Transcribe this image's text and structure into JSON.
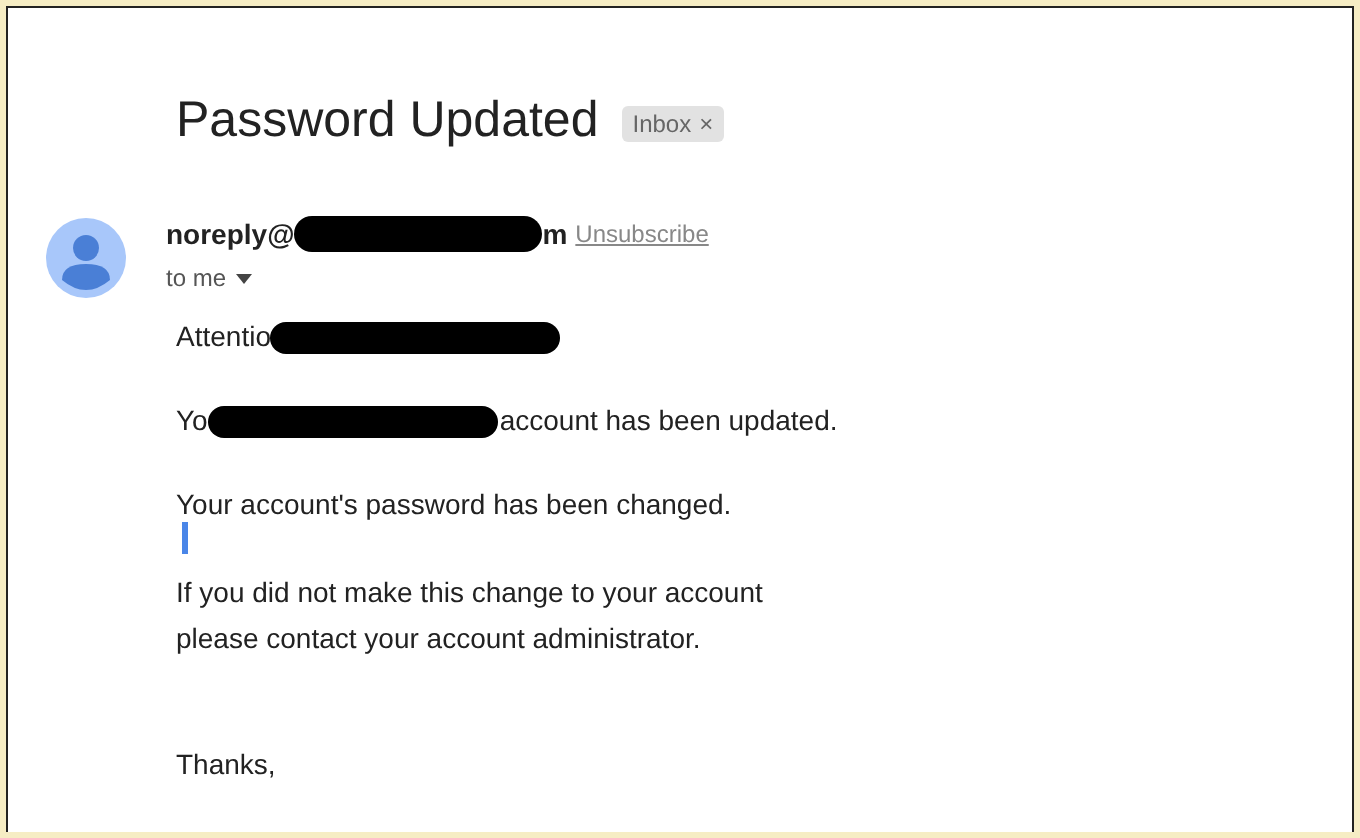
{
  "subject": "Password Updated",
  "label": {
    "text": "Inbox",
    "close": "×"
  },
  "sender": {
    "parts": [
      "noreply@",
      "m"
    ],
    "unsubscribe": "Unsubscribe",
    "recipient": "to me"
  },
  "body": [
    {
      "kind": "paragraph",
      "lines": [
        [
          {
            "kind": "text",
            "text": "Attentio"
          },
          {
            "kind": "redaction"
          }
        ]
      ]
    },
    {
      "kind": "paragraph",
      "lines": [
        [
          {
            "kind": "text",
            "text": "Yo"
          },
          {
            "kind": "redaction"
          },
          {
            "kind": "text",
            "text": "account has been updated."
          }
        ]
      ]
    },
    {
      "kind": "paragraph",
      "lines": [
        [
          {
            "kind": "text",
            "text": "Your account's password has been changed."
          }
        ]
      ]
    },
    {
      "kind": "cursor"
    },
    {
      "kind": "paragraph",
      "lines": [
        [
          {
            "kind": "text",
            "text": "If you did not make this change to your account"
          }
        ],
        [
          {
            "kind": "text",
            "text": "please contact your account administrator."
          }
        ]
      ]
    },
    {
      "kind": "signoff",
      "lines": [
        [
          {
            "kind": "text",
            "text": "Thanks,"
          }
        ]
      ]
    }
  ]
}
